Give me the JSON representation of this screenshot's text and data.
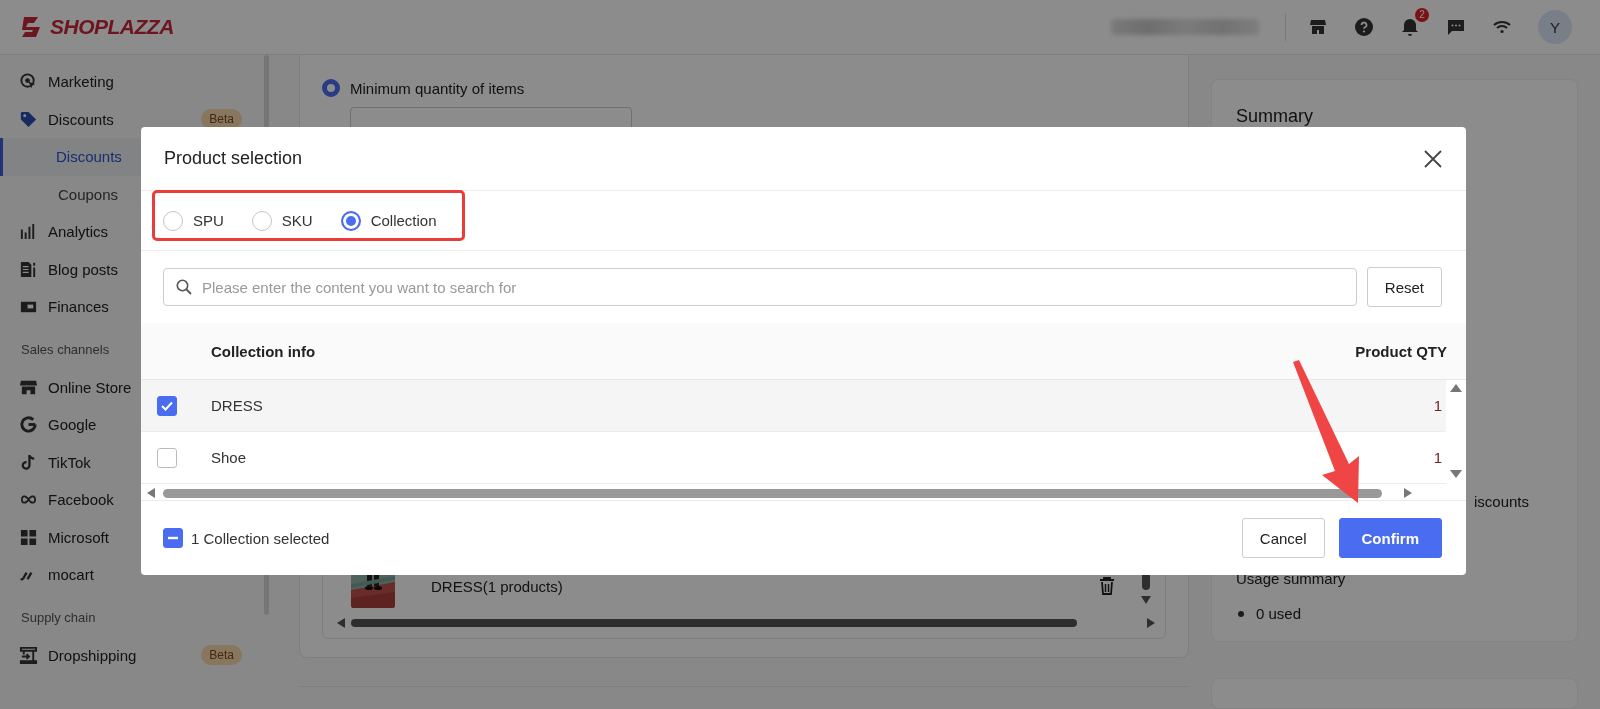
{
  "topbar": {
    "logo": "SHOPLAZZA",
    "notification_count": "2",
    "avatar": "Y"
  },
  "sidebar": {
    "sections": [
      {
        "items": [
          {
            "label": "Marketing",
            "selected": false
          },
          {
            "label": "Discounts",
            "selected": false,
            "badge": "Beta",
            "expanded": true,
            "children": [
              {
                "label": "Discounts",
                "selected": true
              },
              {
                "label": "Coupons",
                "selected": false
              }
            ]
          },
          {
            "label": "Analytics",
            "selected": false
          },
          {
            "label": "Blog posts",
            "selected": false
          },
          {
            "label": "Finances",
            "selected": false
          }
        ]
      },
      {
        "heading": "Sales channels",
        "items": [
          {
            "label": "Online Store",
            "selected": false
          },
          {
            "label": "Google",
            "selected": false
          },
          {
            "label": "TikTok",
            "selected": false
          },
          {
            "label": "Facebook",
            "selected": false
          },
          {
            "label": "Microsoft",
            "selected": false
          },
          {
            "label": "mocart",
            "selected": false
          }
        ]
      },
      {
        "heading": "Supply chain",
        "items": [
          {
            "label": "Dropshipping",
            "selected": false,
            "badge": "Beta"
          }
        ]
      }
    ]
  },
  "main": {
    "option": {
      "label": "Minimum quantity of items",
      "selected": true
    },
    "product_list": {
      "items": [
        {
          "name": "DRESS(1 products)"
        }
      ]
    }
  },
  "summary": {
    "title": "Summary",
    "text_fragment": "iscounts",
    "usage_title": "Usage summary",
    "usage_items": [
      "0 used"
    ]
  },
  "modal": {
    "title": "Product selection",
    "types": [
      {
        "label": "SPU",
        "selected": false
      },
      {
        "label": "SKU",
        "selected": false
      },
      {
        "label": "Collection",
        "selected": true
      }
    ],
    "search": {
      "placeholder": "Please enter the content you want to search for"
    },
    "reset": "Reset",
    "table": {
      "columns": [
        "Collection info",
        "Product QTY"
      ],
      "rows": [
        {
          "checked": true,
          "name": "DRESS",
          "qty": "1"
        },
        {
          "checked": false,
          "name": "Shoe",
          "qty": "1"
        }
      ]
    },
    "footer": {
      "indeterminate": true,
      "selected_text": "1 Collection selected"
    },
    "buttons": [
      {
        "label": "Cancel",
        "kind": "secondary"
      },
      {
        "label": "Confirm",
        "kind": "primary"
      }
    ]
  }
}
